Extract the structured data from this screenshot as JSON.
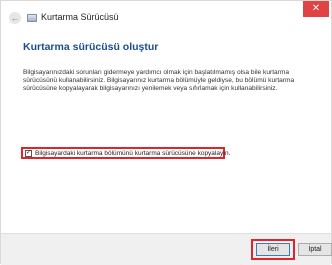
{
  "window": {
    "title": "Kurtarma Sürücüsü",
    "close_icon": "✕",
    "back_icon": "←"
  },
  "main": {
    "heading": "Kurtarma sürücüsü oluştur",
    "description": "Bilgisayarınızdaki sorunları gidermeye yardımcı olmak için başlatılmamış olsa bile kurtarma sürücüsünü kullanabilirsiniz. Bilgisayarınız kurtarma bölümüyle geldiyse, bu bölümü kurtarma sürücüsüne kopyalayarak bilgisayarınızı yenilemek veya sıfırlamak için kullanabilirsiniz.",
    "checkbox_label": "Bilgisayardaki kurtarma bölümünü kurtarma sürücüsüne kopyalayın.",
    "checkbox_mark": "✓",
    "checkbox_checked": true
  },
  "footer": {
    "next_label": "İleri",
    "cancel_label": "İptal"
  },
  "colors": {
    "heading": "#1a4f8f",
    "highlight": "#e0242b",
    "close_button": "#e04343"
  }
}
